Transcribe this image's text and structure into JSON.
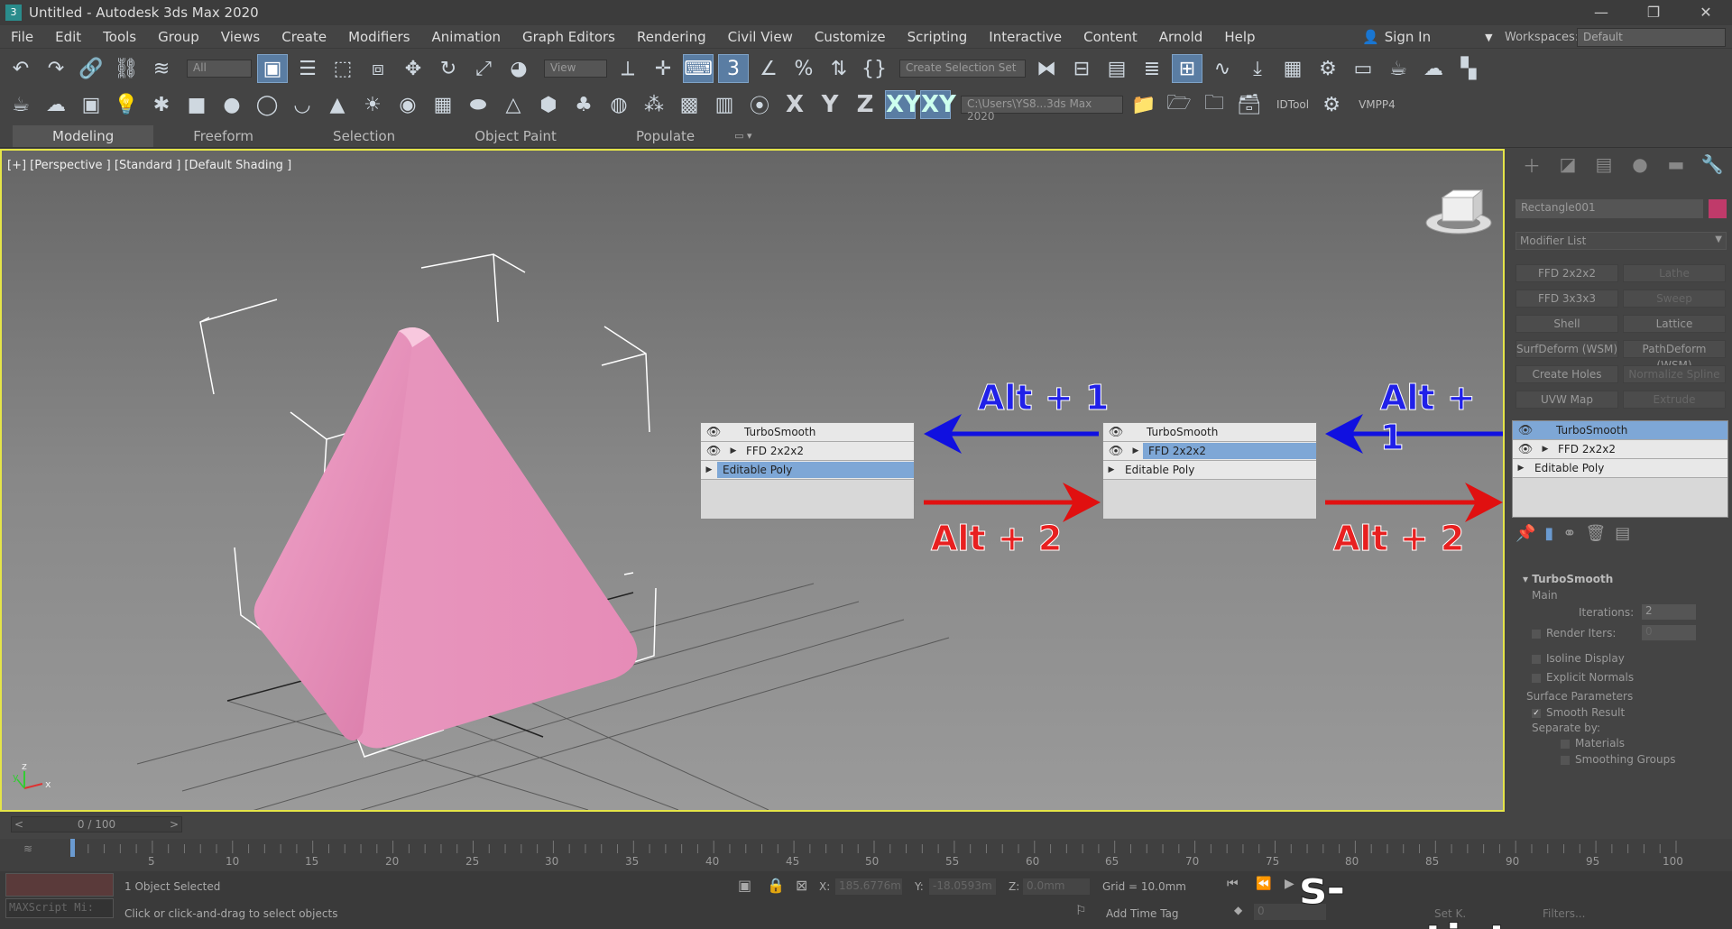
{
  "title": {
    "text": "Untitled - Autodesk 3ds Max 2020"
  },
  "menu": [
    "File",
    "Edit",
    "Tools",
    "Group",
    "Views",
    "Create",
    "Modifiers",
    "Animation",
    "Graph Editors",
    "Rendering",
    "Civil View",
    "Customize",
    "Scripting",
    "Interactive",
    "Content",
    "Arnold",
    "Help"
  ],
  "signin": {
    "label": "Sign In"
  },
  "workspace": {
    "label": "Workspaces:",
    "value": "Default"
  },
  "toolbar": {
    "filter": "All",
    "refcoord": "View",
    "selset": "Create Selection Set",
    "path": "C:\\Users\\YS8...3ds Max 2020",
    "axes": [
      "X",
      "Y",
      "Z",
      "XY",
      "XY"
    ],
    "tool1": "IDTool",
    "tool2": "VMPP4"
  },
  "ribbon": {
    "tabs": [
      "Modeling",
      "Freeform",
      "Selection",
      "Object Paint",
      "Populate"
    ]
  },
  "viewport": {
    "label": "[+] [Perspective ] [Standard ] [Default Shading ]"
  },
  "stacks": [
    {
      "rows": [
        {
          "name": "TurboSmooth"
        },
        {
          "name": "FFD 2x2x2"
        },
        {
          "name": "Editable Poly"
        }
      ]
    },
    {
      "rows": [
        {
          "name": "TurboSmooth"
        },
        {
          "name": "FFD 2x2x2"
        },
        {
          "name": "Editable Poly"
        }
      ]
    },
    {
      "rows": [
        {
          "name": "TurboSmooth"
        },
        {
          "name": "FFD 2x2x2"
        },
        {
          "name": "Editable Poly"
        }
      ]
    }
  ],
  "shortcuts": {
    "up": "Alt + 1",
    "down": "Alt + 2"
  },
  "colors": {
    "up_arrow": "#1010e0",
    "down_arrow": "#e01010",
    "object": "#e890b8",
    "viewport_border": "#e5e548"
  },
  "cmdpanel": {
    "object_name": "Rectangle001",
    "modifier_list": "Modifier List",
    "buttons": [
      "FFD 2x2x2",
      "Lathe",
      "FFD 3x3x3",
      "Sweep",
      "Shell",
      "Lattice",
      "SurfDeform (WSM)",
      "PathDeform (WSM)",
      "Create Holes",
      "Normalize Spline",
      "UVW Map",
      "Extrude"
    ],
    "stack": {
      "rows": [
        {
          "name": "TurboSmooth"
        },
        {
          "name": "FFD 2x2x2"
        },
        {
          "name": "Editable Poly"
        }
      ]
    },
    "rollout": {
      "title": "TurboSmooth",
      "main": "Main",
      "iterations_label": "Iterations:",
      "iterations": "2",
      "render_iters": "Render Iters:",
      "render_iters_val": "0",
      "isoline": "Isoline Display",
      "explicit": "Explicit Normals",
      "surface": "Surface Parameters",
      "smooth": "Smooth Result",
      "separate": "Separate by:",
      "materials": "Materials",
      "groups": "Smoothing Groups"
    }
  },
  "timeline": {
    "slider": "0 / 100",
    "ticks": [
      "5",
      "10",
      "15",
      "20",
      "25",
      "30",
      "35",
      "40",
      "45",
      "50",
      "55",
      "60",
      "65",
      "70",
      "75",
      "80",
      "85",
      "90",
      "95",
      "100"
    ]
  },
  "status": {
    "selected": "1 Object Selected",
    "hint": "Click or click-and-drag to select objects",
    "maxscript": "MAXScript Mi:",
    "x_label": "X:",
    "x": "185.6776m",
    "y_label": "Y:",
    "y": "-18.0593m",
    "z_label": "Z:",
    "z": "0.0mm",
    "grid": "Grid = 10.0mm",
    "add_time_tag": "Add Time Tag",
    "frame": "0",
    "setk": "Set K.",
    "filters": "Filters..."
  },
  "watermark": "s-max.tistory.com"
}
